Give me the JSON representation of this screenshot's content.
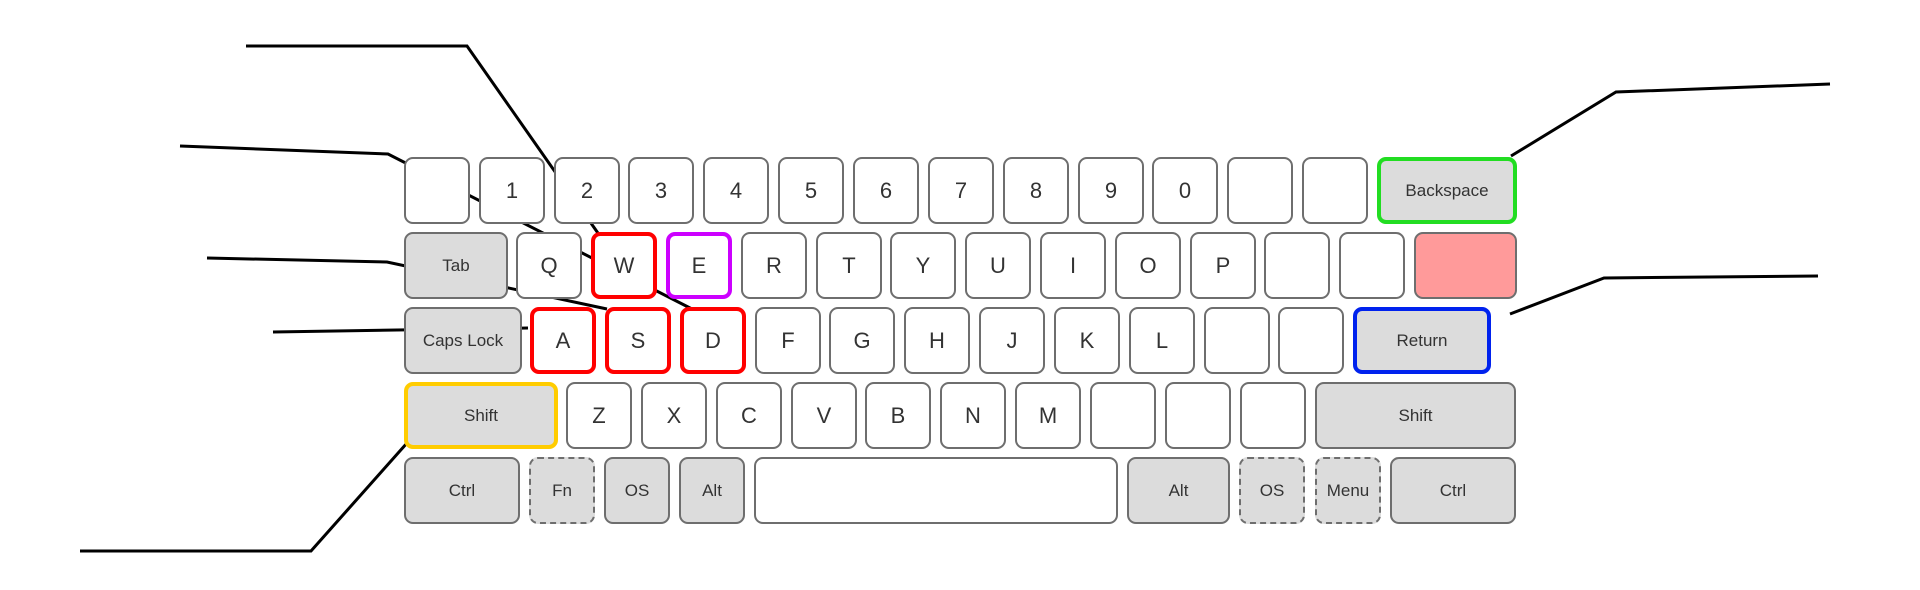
{
  "colors": {
    "wasd_highlight": "#ff0000",
    "e_highlight": "#cc00ff",
    "backspace_highlight": "#22dd22",
    "return_highlight": "#0022ee",
    "shift_highlight": "#ffcc00",
    "pink_key_fill": "#ff9a9a",
    "modifier_fill": "#dcdcdc",
    "key_fill": "#ffffff",
    "key_border": "#6e6e6e",
    "leader_line": "#000000"
  },
  "keyboard": {
    "rows": [
      {
        "keys": [
          {
            "label": "",
            "name": "blank-key-1"
          },
          {
            "label": "1",
            "name": "key-1"
          },
          {
            "label": "2",
            "name": "key-2"
          },
          {
            "label": "3",
            "name": "key-3"
          },
          {
            "label": "4",
            "name": "key-4"
          },
          {
            "label": "5",
            "name": "key-5"
          },
          {
            "label": "6",
            "name": "key-6"
          },
          {
            "label": "7",
            "name": "key-7"
          },
          {
            "label": "8",
            "name": "key-8"
          },
          {
            "label": "9",
            "name": "key-9"
          },
          {
            "label": "0",
            "name": "key-0"
          },
          {
            "label": "",
            "name": "blank-key-2"
          },
          {
            "label": "",
            "name": "blank-key-3"
          },
          {
            "label": "Backspace",
            "name": "backspace-key",
            "mod": true,
            "highlight": "backspace_highlight"
          }
        ]
      },
      {
        "keys": [
          {
            "label": "Tab",
            "name": "tab-key",
            "mod": true
          },
          {
            "label": "Q",
            "name": "key-q"
          },
          {
            "label": "W",
            "name": "key-w",
            "highlight": "wasd_highlight"
          },
          {
            "label": "E",
            "name": "key-e",
            "highlight": "e_highlight"
          },
          {
            "label": "R",
            "name": "key-r"
          },
          {
            "label": "T",
            "name": "key-t"
          },
          {
            "label": "Y",
            "name": "key-y"
          },
          {
            "label": "U",
            "name": "key-u"
          },
          {
            "label": "I",
            "name": "key-i"
          },
          {
            "label": "O",
            "name": "key-o"
          },
          {
            "label": "P",
            "name": "key-p"
          },
          {
            "label": "",
            "name": "blank-key-4"
          },
          {
            "label": "",
            "name": "blank-key-5"
          },
          {
            "label": "",
            "name": "pink-key",
            "fill": "pink_key_fill"
          }
        ]
      },
      {
        "keys": [
          {
            "label": "Caps Lock",
            "name": "caps-lock-key",
            "mod": true
          },
          {
            "label": "A",
            "name": "key-a",
            "highlight": "wasd_highlight"
          },
          {
            "label": "S",
            "name": "key-s",
            "highlight": "wasd_highlight"
          },
          {
            "label": "D",
            "name": "key-d",
            "highlight": "wasd_highlight"
          },
          {
            "label": "F",
            "name": "key-f"
          },
          {
            "label": "G",
            "name": "key-g"
          },
          {
            "label": "H",
            "name": "key-h"
          },
          {
            "label": "J",
            "name": "key-j"
          },
          {
            "label": "K",
            "name": "key-k"
          },
          {
            "label": "L",
            "name": "key-l"
          },
          {
            "label": "",
            "name": "blank-key-6"
          },
          {
            "label": "",
            "name": "blank-key-7"
          },
          {
            "label": "Return",
            "name": "return-key",
            "mod": true,
            "highlight": "return_highlight"
          }
        ]
      },
      {
        "keys": [
          {
            "label": "Shift",
            "name": "left-shift-key",
            "mod": true,
            "highlight": "shift_highlight"
          },
          {
            "label": "Z",
            "name": "key-z"
          },
          {
            "label": "X",
            "name": "key-x"
          },
          {
            "label": "C",
            "name": "key-c"
          },
          {
            "label": "V",
            "name": "key-v"
          },
          {
            "label": "B",
            "name": "key-b"
          },
          {
            "label": "N",
            "name": "key-n"
          },
          {
            "label": "M",
            "name": "key-m"
          },
          {
            "label": "",
            "name": "blank-key-8"
          },
          {
            "label": "",
            "name": "blank-key-9"
          },
          {
            "label": "",
            "name": "blank-key-10"
          },
          {
            "label": "Shift",
            "name": "right-shift-key",
            "mod": true
          }
        ]
      },
      {
        "keys": [
          {
            "label": "Ctrl",
            "name": "left-ctrl-key",
            "mod": true
          },
          {
            "label": "Fn",
            "name": "fn-key",
            "mod": true,
            "dashed": true
          },
          {
            "label": "OS",
            "name": "left-os-key",
            "mod": true
          },
          {
            "label": "Alt",
            "name": "left-alt-key",
            "mod": true
          },
          {
            "label": "",
            "name": "spacebar"
          },
          {
            "label": "Alt",
            "name": "right-alt-key",
            "mod": true
          },
          {
            "label": "OS",
            "name": "right-os-key",
            "mod": true,
            "dashed": true
          },
          {
            "label": "Menu",
            "name": "menu-key",
            "mod": true,
            "dashed": true
          },
          {
            "label": "Ctrl",
            "name": "right-ctrl-key",
            "mod": true
          }
        ]
      }
    ]
  }
}
